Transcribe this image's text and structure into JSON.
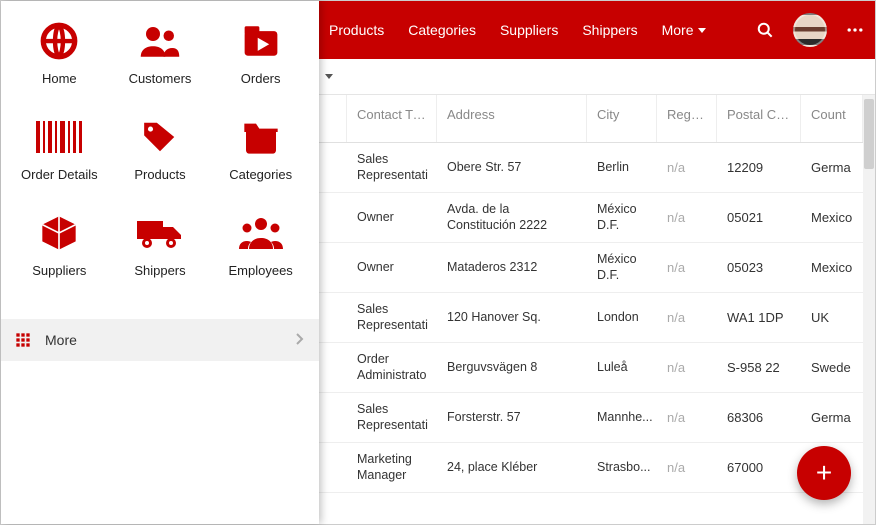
{
  "topnav": {
    "items": [
      "Products",
      "Categories",
      "Suppliers",
      "Shippers"
    ],
    "more": "More"
  },
  "subbar": {
    "dropdown": ""
  },
  "sidebar": {
    "tiles": [
      {
        "label": "Home",
        "icon": "globe-icon"
      },
      {
        "label": "Customers",
        "icon": "people-icon"
      },
      {
        "label": "Orders",
        "icon": "folder-play-icon"
      },
      {
        "label": "Order Details",
        "icon": "barcode-icon"
      },
      {
        "label": "Products",
        "icon": "tag-icon"
      },
      {
        "label": "Categories",
        "icon": "cabinet-icon"
      },
      {
        "label": "Suppliers",
        "icon": "box-icon"
      },
      {
        "label": "Shippers",
        "icon": "truck-icon"
      },
      {
        "label": "Employees",
        "icon": "group-icon"
      }
    ],
    "more": "More"
  },
  "grid": {
    "columns": [
      "Contact Title",
      "Address",
      "City",
      "Region",
      "Postal Code",
      "Count"
    ],
    "columns_full": {
      "c5": "Country"
    },
    "rows": [
      {
        "title": "Sales Representative",
        "titleShow": "Sales Representati",
        "address": "Obere Str. 57",
        "city": "Berlin",
        "region": "n/a",
        "postal": "12209",
        "country": "Germa"
      },
      {
        "title": "Owner",
        "titleShow": "Owner",
        "address": "Avda. de la Constitución 2222",
        "city": "México D.F.",
        "region": "n/a",
        "postal": "05021",
        "country": "Mexico"
      },
      {
        "title": "Owner",
        "titleShow": "Owner",
        "address": "Mataderos 2312",
        "city": "México D.F.",
        "region": "n/a",
        "postal": "05023",
        "country": "Mexico"
      },
      {
        "title": "Sales Representative",
        "titleShow": "Sales Representati",
        "address": "120 Hanover Sq.",
        "city": "London",
        "region": "n/a",
        "postal": "WA1 1DP",
        "country": "UK"
      },
      {
        "title": "Order Administrator",
        "titleShow": "Order Administrato",
        "address": "Berguvsvägen 8",
        "city": "Luleå",
        "region": "n/a",
        "postal": "S-958 22",
        "country": "Swede"
      },
      {
        "title": "Sales Representative",
        "titleShow": "Sales Representati",
        "address": "Forsterstr. 57",
        "city": "Mannhe...",
        "region": "n/a",
        "postal": "68306",
        "country": "Germa"
      },
      {
        "title": "Marketing Manager",
        "titleShow": "Marketing Manager",
        "address": "24, place Kléber",
        "city": "Strasbo...",
        "region": "n/a",
        "postal": "67000",
        "country": ""
      }
    ]
  },
  "fab": {
    "label": "+"
  }
}
